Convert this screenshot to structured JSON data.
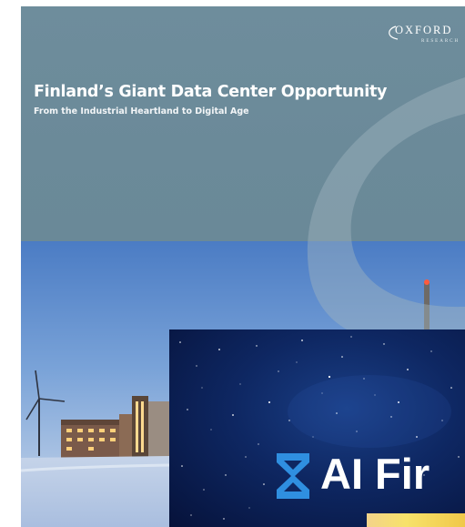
{
  "cover": {
    "title": "Finland’s Giant Data Center Opportunity",
    "subtitle": "From the Industrial Heartland to Digital Age",
    "logo_text": "OXFORD",
    "logo_subtext": "RESEARCH"
  },
  "overlay": {
    "title": "AI Fir",
    "logo_icon": "hourglass-x-logo-icon"
  },
  "colors": {
    "cover_bg": "#6f8e9d",
    "sky_top": "#3f6fb7",
    "snow": "#cfdcec",
    "overlay_bg": "#0e2762",
    "overlay_logo": "#2f8fe0",
    "strip": "#f7e26a"
  }
}
